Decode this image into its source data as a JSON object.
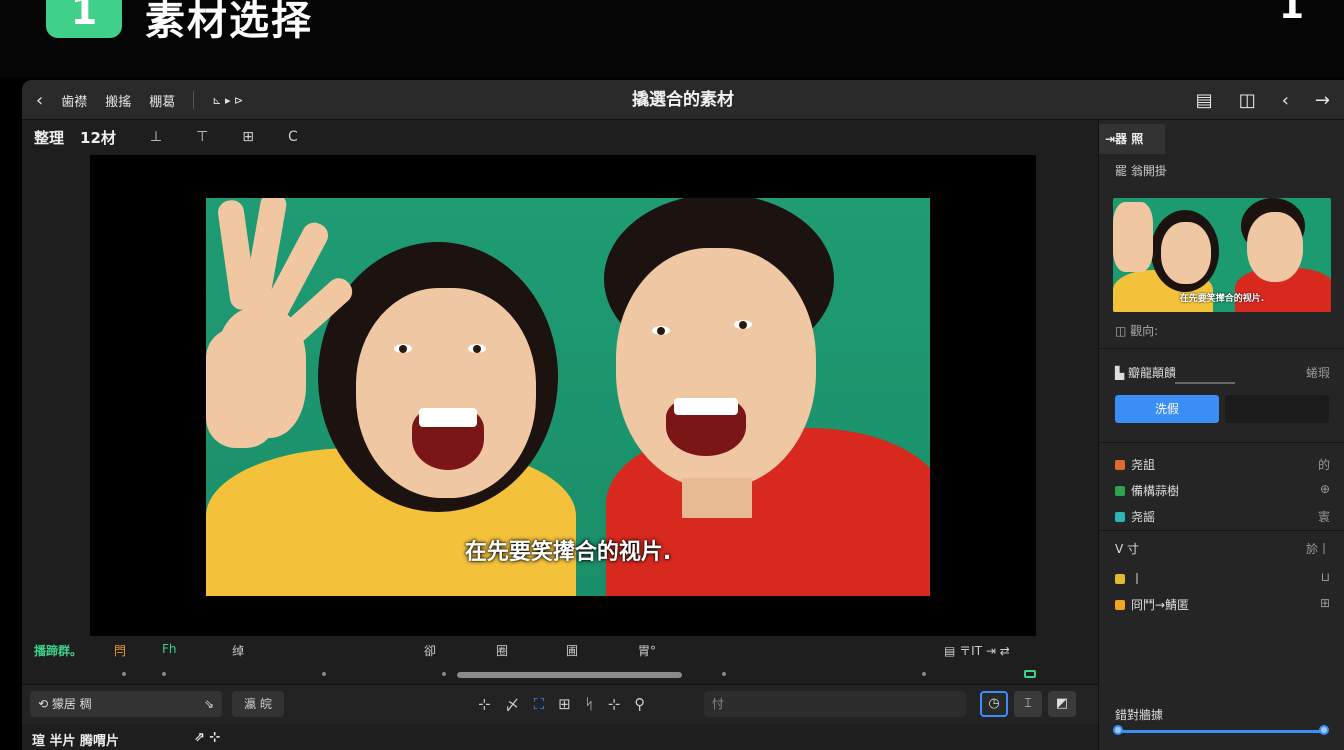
{
  "banner": {
    "step_number": "1",
    "title": "素材选择",
    "right_glyph": "1"
  },
  "titlebar": {
    "back_icon": "‹",
    "menu": [
      "歯襟",
      "搬搖",
      "棚葛"
    ],
    "extra": "⊾ ▸ ⊳",
    "title": "撬選合的素材",
    "right_icons": [
      "▤",
      "◫",
      "‹",
      "→"
    ]
  },
  "toolrow": {
    "label1": "整理",
    "label2": "12材",
    "icons": [
      "⊥",
      "⊤",
      "⊞",
      "C"
    ]
  },
  "preview": {
    "subtitle": "在先要笑撵合的视片."
  },
  "controls": {
    "left_green": "播蹄群。",
    "items": [
      "閂",
      "Fh",
      "绰",
      "卻",
      "圈",
      "圃",
      "胃°"
    ],
    "right": "▤ 〒IT ⇥ ⇄"
  },
  "bottombar": {
    "field1": "⟲ 獴居 稠",
    "field1_icon": "⇘",
    "field2": "瀛 皖",
    "tools": [
      "⊹",
      "〆",
      "⛶",
      "⊞",
      "ᛋ",
      "⊹",
      "⚲"
    ],
    "input": "忖",
    "right_buttons": [
      "◷",
      "⌶",
      "◩"
    ]
  },
  "trackrow": {
    "label": "瑄 半片 腾喟片",
    "icons": "⇗ ⊹"
  },
  "rpanel": {
    "tab": "⇥器 照",
    "head": "罷 翁開掛",
    "thumb_caption": "在先要笑撵合的视片.",
    "meta": "◫ 觀向:",
    "slider_label": "▙ 瓣龍顛饋",
    "slider_right": "蜷瑕",
    "primary_button": "洗假",
    "list": [
      {
        "label": "尧詛",
        "right": "的",
        "color": "#e06a2b"
      },
      {
        "label": "備構蒜樹",
        "right": "⊕",
        "color": "#2ea44f"
      },
      {
        "label": "尧謡",
        "right": "㝨",
        "color": "#2bb5b5"
      },
      {
        "label": "ᐯ 寸",
        "right": "㫆丨",
        "color": ""
      },
      {
        "label": "丨",
        "right": "⊔",
        "color": "#e5b92b"
      },
      {
        "label": "冏鬥→鯖匿",
        "right": "⊞",
        "color": "#f0a41b"
      }
    ],
    "bottom_label": "錯對牆據"
  }
}
